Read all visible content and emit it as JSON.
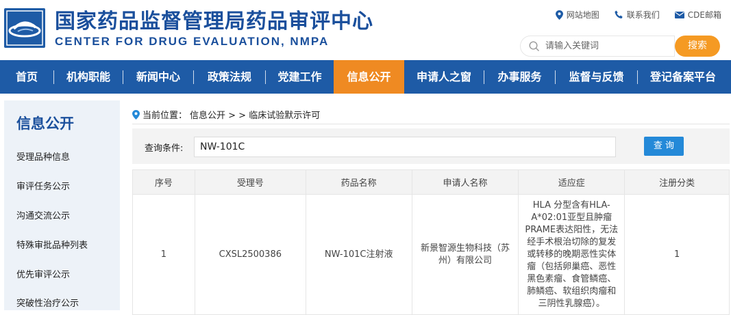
{
  "header": {
    "title_cn": "国家药品监督管理局药品审评中心",
    "title_en": "CENTER FOR DRUG EVALUATION, NMPA",
    "links": [
      "网站地图",
      "联系我们",
      "CDE邮箱"
    ],
    "search_placeholder": "请输入关键词",
    "search_button": "搜索"
  },
  "nav": {
    "items": [
      "首页",
      "机构职能",
      "新闻中心",
      "政策法规",
      "党建工作",
      "信息公开",
      "申请人之窗",
      "办事服务",
      "监督与反馈",
      "登记备案平台"
    ],
    "active": "信息公开"
  },
  "sidebar": {
    "title": "信息公开",
    "items": [
      "受理品种信息",
      "审评任务公示",
      "沟通交流公示",
      "特殊审批品种列表",
      "优先审评公示",
      "突破性治疗公示"
    ]
  },
  "breadcrumb": {
    "label": "当前位置：",
    "path": "信息公开 > > 临床试验默示许可"
  },
  "query": {
    "label": "查询条件:",
    "value": "NW-101C",
    "button": "查 询"
  },
  "table": {
    "columns": [
      "序号",
      "受理号",
      "药品名称",
      "申请人名称",
      "适应症",
      "注册分类"
    ],
    "rows": [
      {
        "index": "1",
        "accept_no": "CXSL2500386",
        "drug_name": "NW-101C注射液",
        "applicant": "新景智源生物科技（苏州）有限公司",
        "indication": "HLA 分型含有HLA-A*02:01亚型且肿瘤PRAME表达阳性，无法经手术根治切除的复发或转移的晚期恶性实体瘤（包括卵巢癌、恶性黑色素瘤、食管鳞癌、肺鳞癌、软组织肉瘤和三阴性乳腺癌）。",
        "reg_class": "1"
      }
    ]
  },
  "colors": {
    "brand_blue": "#1e5ba6",
    "accent_orange": "#ef8a22",
    "query_button": "#2489d8"
  }
}
